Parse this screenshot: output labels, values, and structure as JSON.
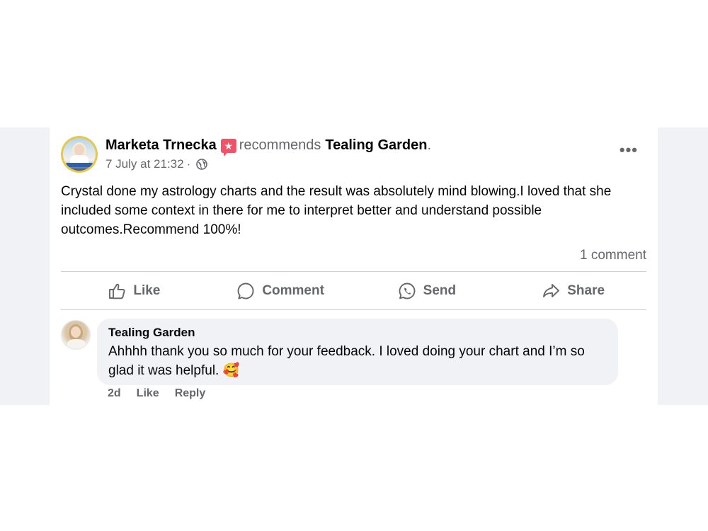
{
  "post": {
    "author": "Marketa Trnecka",
    "recommends_word": "recommends",
    "page_name": "Tealing Garden",
    "page_suffix": ".",
    "timestamp": "7 July at 21:32",
    "separator": "·",
    "privacy_icon": "globe-icon",
    "recommend_icon": "star-badge-icon",
    "more_label": "•••",
    "text": "Crystal done my astrology charts and  the result was absolutely mind blowing.I loved that she included some context in there for me to interpret better and understand possible outcomes.Recommend 100%!",
    "comment_count": "1 comment"
  },
  "actions": {
    "like": "Like",
    "comment": "Comment",
    "send": "Send",
    "share": "Share"
  },
  "comment": {
    "author": "Tealing Garden",
    "text": "Ahhhh thank you so much for your feedback. I loved doing your chart and I’m so glad it was helpful.",
    "emoji": "🥰",
    "age": "2d",
    "like": "Like",
    "reply": "Reply"
  },
  "colors": {
    "text_primary": "#050505",
    "text_secondary": "#65676b",
    "recommend_badge": "#f25268",
    "bubble": "#f0f2f5",
    "avatar_ring": "#e7c84a"
  }
}
